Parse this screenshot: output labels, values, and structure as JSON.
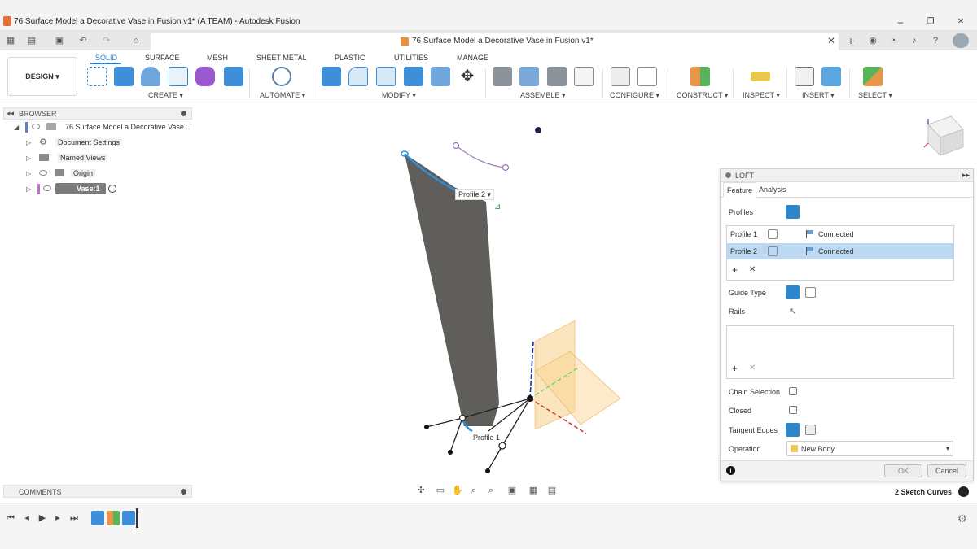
{
  "window": {
    "title": "76 Surface Model a Decorative Vase in Fusion v1* (A TEAM) - Autodesk Fusion",
    "minimize": "–",
    "maximize": "❐",
    "close": "✕"
  },
  "doc_tab": {
    "label": "76 Surface Model a Decorative Vase in Fusion v1*",
    "close": "✕"
  },
  "ribbon": {
    "workspace": "DESIGN ▾",
    "tabs": [
      "SOLID",
      "SURFACE",
      "MESH",
      "SHEET METAL",
      "PLASTIC",
      "UTILITIES",
      "MANAGE"
    ],
    "groups": [
      "CREATE ▾",
      "AUTOMATE ▾",
      "MODIFY ▾",
      "ASSEMBLE ▾",
      "CONFIGURE ▾",
      "CONSTRUCT ▾",
      "INSPECT ▾",
      "INSERT ▾",
      "SELECT ▾"
    ]
  },
  "browser": {
    "title": "BROWSER",
    "root": "76 Surface Model a Decorative Vase ...",
    "items": [
      "Document Settings",
      "Named Views",
      "Origin",
      "Vase:1"
    ]
  },
  "comments": {
    "title": "COMMENTS"
  },
  "viewport": {
    "profile2_label": "Profile 2",
    "profile1_label": "Profile 1"
  },
  "loft": {
    "title": "LOFT",
    "tabs": [
      "Feature",
      "Analysis"
    ],
    "profiles_label": "Profiles",
    "profiles": [
      {
        "name": "Profile 1",
        "status": "Connected"
      },
      {
        "name": "Profile 2",
        "status": "Connected"
      }
    ],
    "add": "+",
    "remove": "✕",
    "guide_type_label": "Guide Type",
    "rails_label": "Rails",
    "chain_selection_label": "Chain Selection",
    "closed_label": "Closed",
    "tangent_edges_label": "Tangent Edges",
    "operation_label": "Operation",
    "operation_value": "New Body",
    "info": "i",
    "ok": "OK",
    "cancel": "Cancel"
  },
  "status": {
    "text": "2 Sketch Curves"
  },
  "colors": {
    "accent": "#2d86c9",
    "surface": "#5f5e5a",
    "selection_edge": "#2d8fd9",
    "plane": "#f5c97a"
  }
}
